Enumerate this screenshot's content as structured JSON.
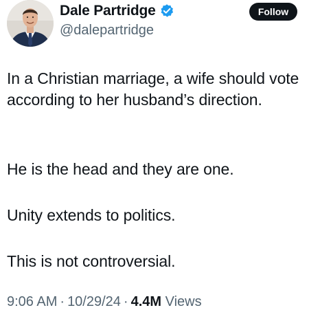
{
  "author": {
    "display_name": "Dale Partridge",
    "handle": "@dalepartridge",
    "verified": true,
    "verified_color": "#1d9bf0"
  },
  "follow_label": "Follow",
  "tweet": {
    "paragraphs": [
      "In a Christian marriage, a wife should vote according to her husband’s direction.",
      "He is the head and they are one.",
      "Unity extends to politics.",
      "This is not controversial."
    ]
  },
  "meta": {
    "time": "9:06 AM",
    "separator": "·",
    "date": "10/29/24",
    "views_count": "4.4M",
    "views_label": "Views"
  },
  "icons": {
    "verified": "verified-badge-icon",
    "avatar": "profile-photo"
  }
}
